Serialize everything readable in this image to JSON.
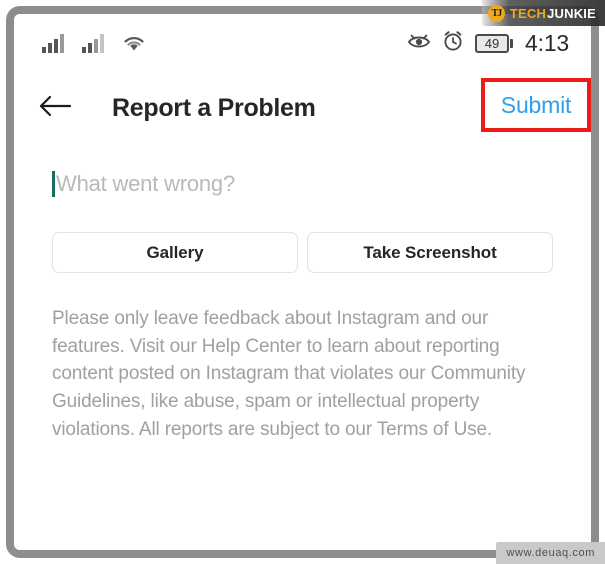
{
  "watermarks": {
    "top_badge": "TJ",
    "top_brand_primary": "TECH",
    "top_brand_secondary": "JUNKIE",
    "bottom_url": "www.deuaq.com"
  },
  "status_bar": {
    "signal_icon_1": "cellular-signal-icon",
    "signal_icon_2": "cellular-signal-icon",
    "wifi_icon": "wifi-icon",
    "eye_icon": "eye-icon",
    "alarm_icon": "alarm-clock-icon",
    "battery_level": "49",
    "time": "4:13"
  },
  "header": {
    "back_icon": "back-arrow-icon",
    "title": "Report a Problem",
    "submit_label": "Submit",
    "submit_color": "#2f9fe8",
    "highlight_color": "#ee1c17"
  },
  "form": {
    "feedback_placeholder": "What went wrong?",
    "caret_color": "#1a6b63",
    "gallery_label": "Gallery",
    "screenshot_label": "Take Screenshot"
  },
  "disclaimer": {
    "text": "Please only leave feedback about Instagram and our features. Visit our Help Center to learn about reporting content posted on Instagram that violates our Community Guidelines, like abuse, spam or intellectual property violations. All reports are subject to our Terms of Use."
  }
}
